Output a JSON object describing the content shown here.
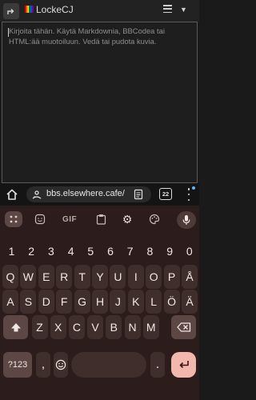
{
  "header": {
    "username": "LockeCJ",
    "flag_colors": [
      "#e40303",
      "#ff8c00",
      "#ffed00",
      "#008026",
      "#004dff",
      "#750787"
    ]
  },
  "editor": {
    "placeholder": "Kirjoita tähän. Käytä Markdownia, BBCodea tai HTML:ää muotoiluun. Vedä tai pudota kuvia."
  },
  "browser": {
    "url": "bbs.elsewhere.cafe/t",
    "tab_count": "22"
  },
  "keyboard": {
    "toolbar": {
      "gif_label": "GIF"
    },
    "number_row": [
      "1",
      "2",
      "3",
      "4",
      "5",
      "6",
      "7",
      "8",
      "9",
      "0"
    ],
    "row1": [
      "Q",
      "W",
      "E",
      "R",
      "T",
      "Y",
      "U",
      "I",
      "O",
      "P",
      "Å"
    ],
    "row2": [
      "A",
      "S",
      "D",
      "F",
      "G",
      "H",
      "J",
      "K",
      "L",
      "Ö",
      "Ä"
    ],
    "row3": [
      "Z",
      "X",
      "C",
      "V",
      "B",
      "N",
      "M"
    ],
    "symbols_label": "?123",
    "comma_label": ","
  },
  "colors": {
    "keyboard_bg": "#2c1d1c",
    "key_bg": "#3f2e2c",
    "function_key_bg": "#5c4744",
    "enter_key_bg": "#f2b8ae",
    "notification_dot": "#5fb8ff"
  }
}
